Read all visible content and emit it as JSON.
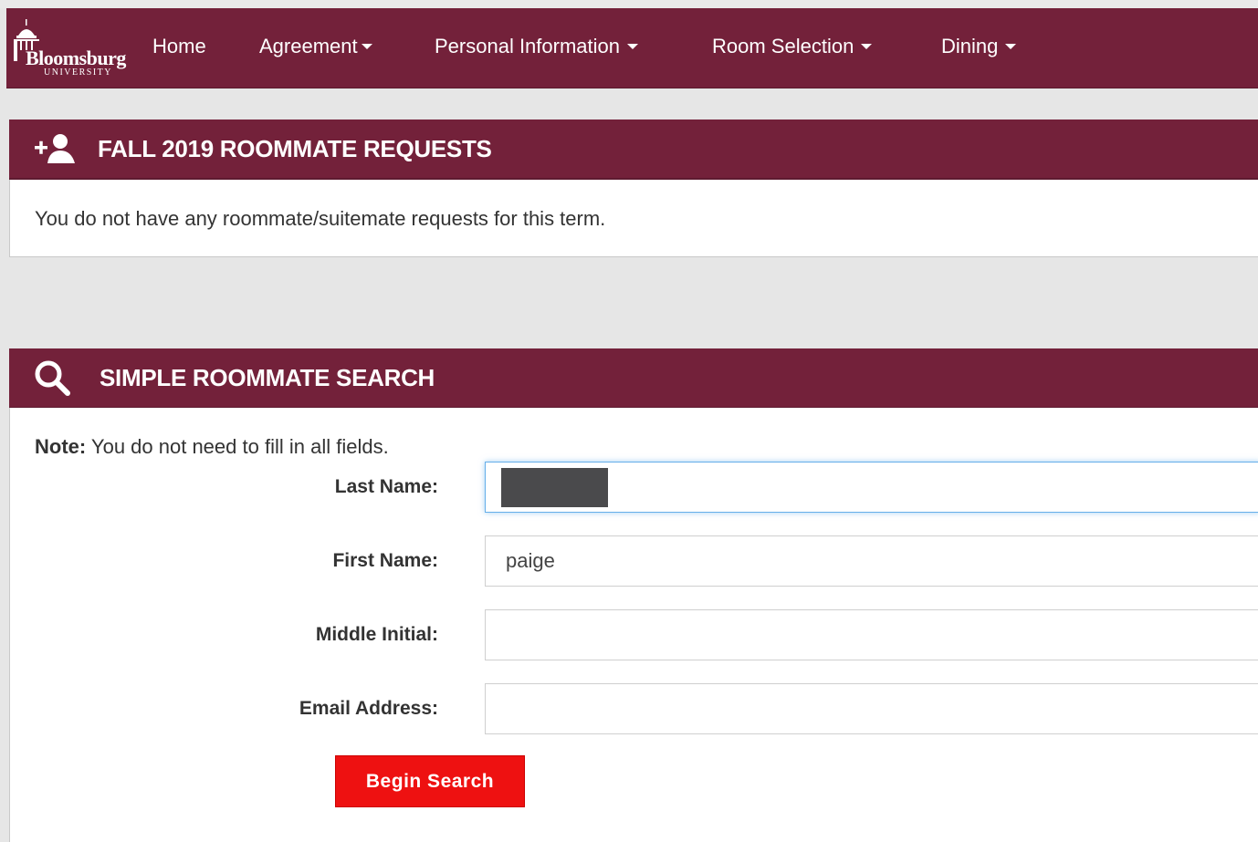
{
  "brand": {
    "name": "Bloomsburg",
    "subtitle": "UNIVERSITY",
    "nav_color": "#73213a"
  },
  "nav": {
    "items": [
      {
        "label": "Home",
        "has_dropdown": false
      },
      {
        "label": "Agreement",
        "has_dropdown": true
      },
      {
        "label": "Personal Information",
        "has_dropdown": true
      },
      {
        "label": "Room Selection",
        "has_dropdown": true
      },
      {
        "label": "Dining",
        "has_dropdown": true
      }
    ]
  },
  "requests_panel": {
    "title": "FALL 2019 ROOMMATE REQUESTS",
    "icon": "add-user-icon",
    "message": "You do not have any roommate/suitemate requests for this term."
  },
  "search_panel": {
    "title": "SIMPLE ROOMMATE SEARCH",
    "icon": "search-icon",
    "note_label": "Note:",
    "note_text": " You do not need to fill in all fields.",
    "fields": {
      "last_name": {
        "label": "Last Name:",
        "value": ""
      },
      "first_name": {
        "label": "First Name:",
        "value": "paige"
      },
      "middle_initial": {
        "label": "Middle Initial:",
        "value": ""
      },
      "email": {
        "label": "Email Address:",
        "value": ""
      }
    },
    "button_label": "Begin Search",
    "button_color": "#ee1111"
  }
}
